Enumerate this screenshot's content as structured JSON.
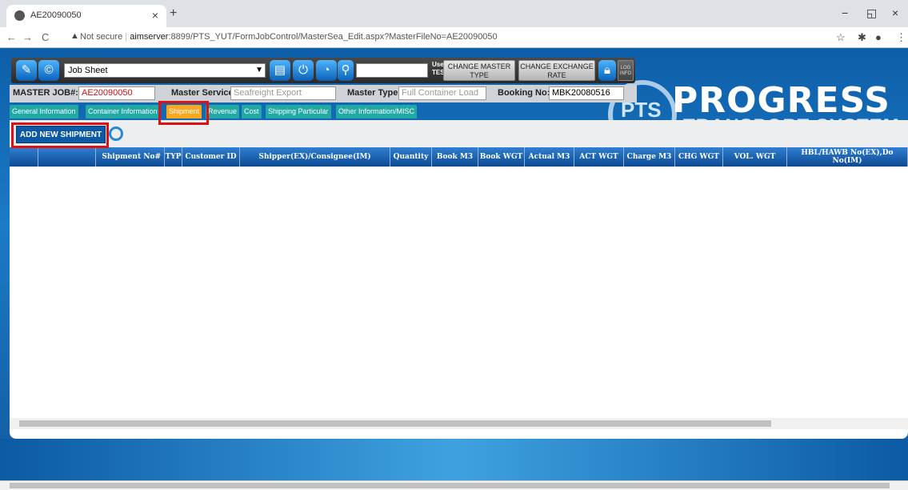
{
  "browser": {
    "tab_title": "AE20090050",
    "tab_close": "×",
    "new_tab": "+",
    "win_min": "−",
    "win_restore": "◱",
    "win_close": "×",
    "back": "←",
    "forward": "→",
    "reload": "C",
    "security_warning": "▲",
    "not_secure": "Not secure",
    "url_host": "aimserver",
    "url_rest": ":8899/PTS_YUT/FormJobControl/MasterSea_Edit.aspx?MasterFileNo=AE20090050",
    "star": "☆",
    "ext": "✱",
    "profile": "●",
    "menu": "⋮"
  },
  "toolbar": {
    "job_select": "Job Sheet",
    "user_label": "User:",
    "user_value": "TEST",
    "change_master_type": "CHANGE MASTER TYPE",
    "change_exchange_rate": "CHANGE EXCHANGE RATE",
    "log_info": "LOG INFO"
  },
  "master": {
    "job_label": "MASTER JOB#:",
    "job_value": "AE20090050",
    "service_label": "Master Service:",
    "service_value": "Seafreight Export",
    "type_label": "Master Type:",
    "type_value": "Full Container Load",
    "booking_label": "Booking No:",
    "booking_value": "MBK20080516"
  },
  "tabs": [
    "General Information",
    "Container Information",
    "Shipment",
    "Revenue",
    "Cost",
    "Shipping Particular",
    "Other Information/MISC"
  ],
  "active_tab": "Shipment",
  "add_button": "ADD NEW SHIPMENT",
  "grid_columns": [
    "Shipment No#",
    "TYP",
    "Customer ID",
    "Shipper(EX)/Consignee(IM)",
    "Quantity",
    "Book M3",
    "Book WGT",
    "Actual M3",
    "ACT WGT",
    "Charge M3",
    "CHG WGT",
    "VOL. WGT",
    "HBL/HAWB No(EX),Do No(IM)"
  ],
  "logo": {
    "pts": "PTS",
    "big": "PROGRESS",
    "small": "TRANSPORT SYSTEM"
  },
  "colors": {
    "accent": "#0c5aa6",
    "tab": "#21a9a5",
    "tab_active": "#f7a81e",
    "highlight": "#e01010"
  }
}
